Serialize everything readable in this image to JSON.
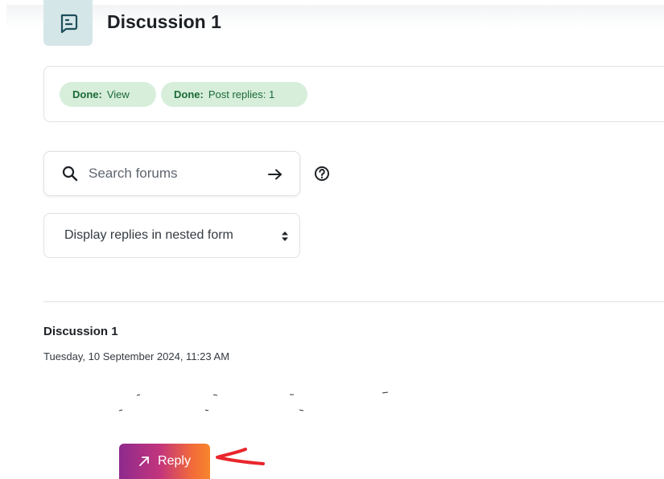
{
  "header": {
    "title": "Discussion 1",
    "icon": "forum-icon"
  },
  "completion": {
    "badges": [
      {
        "prefix": "Done:",
        "text": "View"
      },
      {
        "prefix": "Done:",
        "text": "Post replies: 1"
      }
    ]
  },
  "search": {
    "placeholder": "Search forums",
    "value": "",
    "submit_icon": "arrow-right-icon",
    "help_icon": "question-circle-icon"
  },
  "display_mode": {
    "selected": "Display replies in nested form"
  },
  "post": {
    "subject": "Discussion 1",
    "date": "Tuesday, 10 September 2024, 11:23 AM"
  },
  "actions": {
    "reply_label": "Reply",
    "reply_icon": "arrow-up-right-icon"
  },
  "colors": {
    "badge_bg": "#d7eedb",
    "badge_text": "#1b6a36",
    "icon_tile": "#d5e6e8",
    "annotation": "#e8262b"
  }
}
